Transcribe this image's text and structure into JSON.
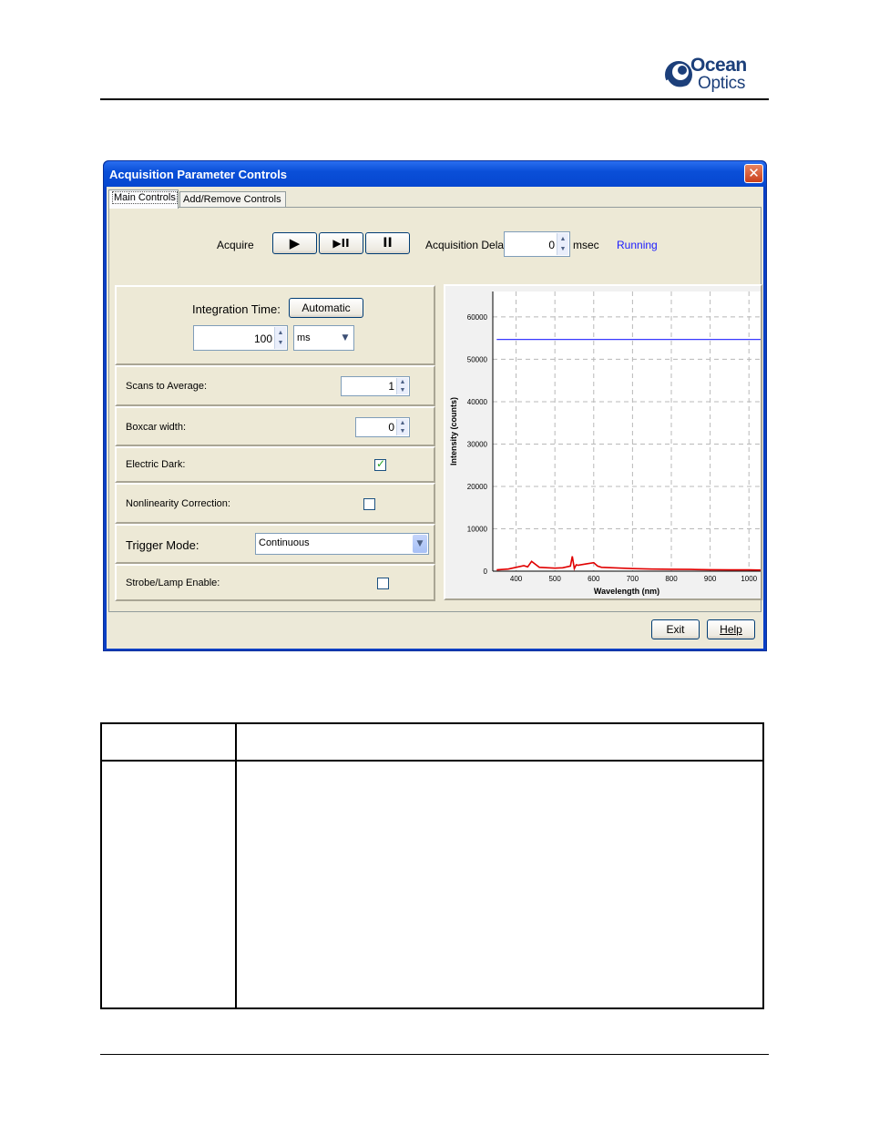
{
  "header": {
    "logo_word1": "Ocean",
    "logo_word2": "Optics"
  },
  "window": {
    "title": "Acquisition Parameter Controls",
    "close_glyph": "✕",
    "tabs": [
      {
        "label": "Main Controls",
        "active": true
      },
      {
        "label": "Add/Remove Controls",
        "active": false
      }
    ],
    "acquire": {
      "label": "Acquire",
      "buttons": [
        {
          "icon": "play-icon",
          "glyph": "▶"
        },
        {
          "icon": "play-pause-icon",
          "glyph": "▶II"
        },
        {
          "icon": "pause-icon",
          "glyph": "II"
        }
      ],
      "delay_label": "Acquisition Delay",
      "delay_value": "0",
      "delay_unit": "msec",
      "status": "Running",
      "status_color": "#1a1aff"
    },
    "integration": {
      "label": "Integration Time:",
      "auto_button": "Automatic",
      "value": "100",
      "unit": "ms"
    },
    "scans_to_average": {
      "label": "Scans to Average:",
      "value": "1"
    },
    "boxcar_width": {
      "label": "Boxcar width:",
      "value": "0"
    },
    "electric_dark": {
      "label": "Electric Dark:",
      "checked": true
    },
    "nonlinearity": {
      "label": "Nonlinearity Correction:",
      "checked": false
    },
    "trigger_mode": {
      "label": "Trigger Mode:",
      "value": "Continuous"
    },
    "strobe_lamp": {
      "label": "Strobe/Lamp Enable:",
      "checked": false
    },
    "footer": {
      "exit_label": "Exit",
      "help_label": "Help"
    }
  },
  "chart_data": {
    "type": "line",
    "xlabel": "Wavelength (nm)",
    "ylabel": "Intensity (counts)",
    "xlim": [
      340,
      1030
    ],
    "ylim": [
      0,
      66000
    ],
    "x_ticks": [
      400,
      500,
      600,
      700,
      800,
      900,
      1000
    ],
    "y_ticks": [
      0,
      10000,
      20000,
      30000,
      40000,
      50000,
      60000
    ],
    "grid": true,
    "series": [
      {
        "color": "#3a3aff",
        "x": [
          350,
          1030
        ],
        "y": [
          54700,
          54700
        ]
      },
      {
        "color": "#e00000",
        "x": [
          350,
          380,
          400,
          420,
          430,
          440,
          460,
          500,
          520,
          540,
          545,
          550,
          555,
          560,
          580,
          600,
          610,
          620,
          650,
          700,
          750,
          800,
          850,
          900,
          950,
          1000,
          1030
        ],
        "y": [
          300,
          500,
          900,
          1300,
          1000,
          2300,
          900,
          700,
          800,
          1200,
          3500,
          600,
          1500,
          1400,
          1700,
          2000,
          1200,
          900,
          800,
          600,
          500,
          450,
          400,
          350,
          300,
          300,
          250
        ]
      }
    ]
  }
}
